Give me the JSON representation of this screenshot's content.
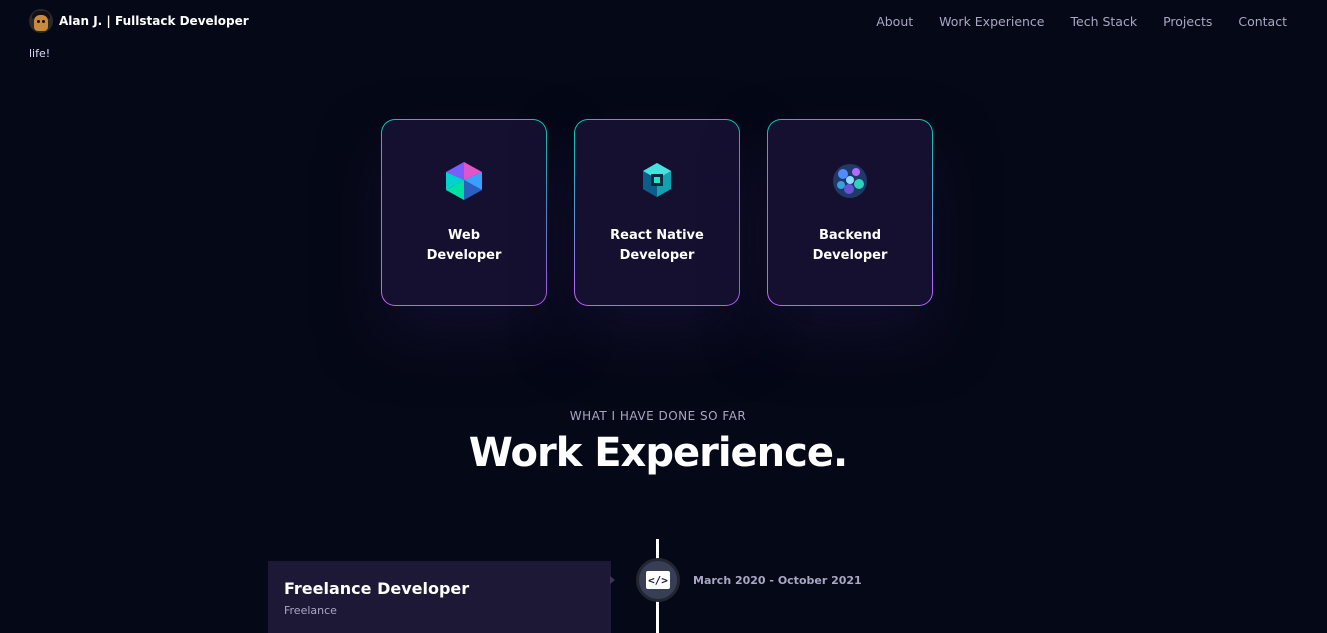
{
  "navbar": {
    "brand": "Alan J. | Fullstack Developer",
    "links": [
      "About",
      "Work Experience",
      "Tech Stack",
      "Projects",
      "Contact"
    ]
  },
  "intro_tail": "life!",
  "services": [
    {
      "title": "Web Developer",
      "icon": "web-polyhedron-icon"
    },
    {
      "title": "React Native Developer",
      "icon": "mobile-cube-icon"
    },
    {
      "title": "Backend Developer",
      "icon": "backend-sphere-icon"
    }
  ],
  "experience": {
    "subtitle": "What I have done so far",
    "heading": "Work Experience.",
    "items": [
      {
        "title": "Freelance Developer",
        "company": "Freelance",
        "date": "March 2020 - October 2021",
        "icon": "code-icon"
      }
    ]
  },
  "colors": {
    "background": "#050816",
    "card": "#151030",
    "accent_green": "#00cea8",
    "accent_purple": "#bf61ff",
    "secondary_text": "#aaa6c3"
  }
}
